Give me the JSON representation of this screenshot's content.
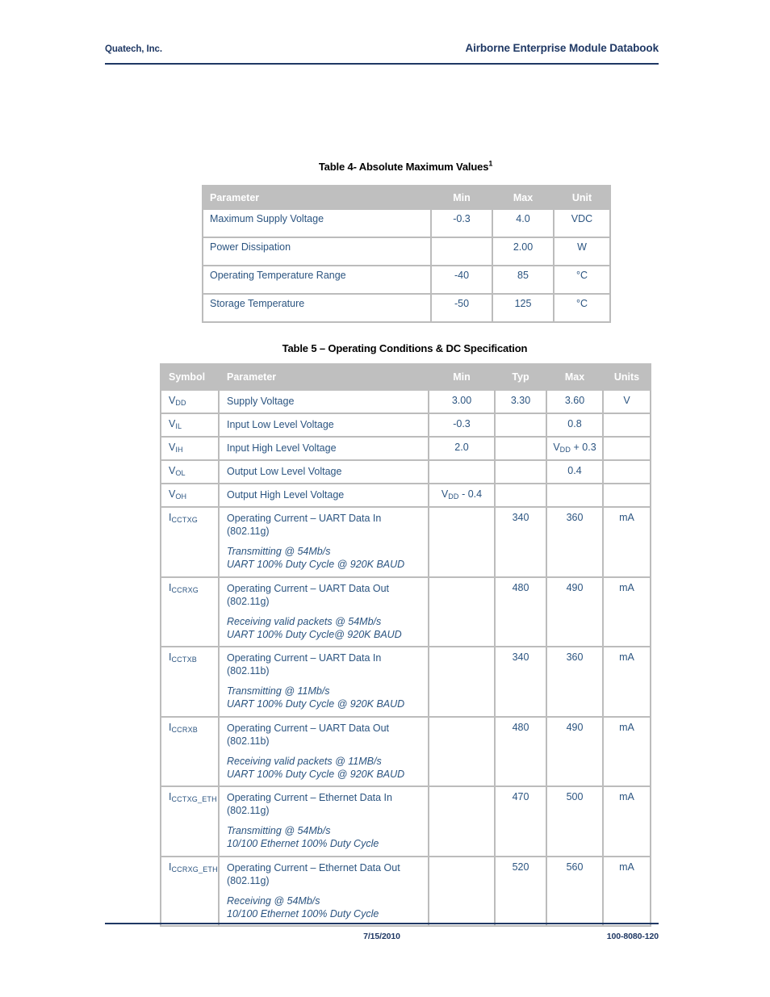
{
  "header": {
    "left": "Quatech, Inc.",
    "right": "Airborne Enterprise Module Databook"
  },
  "footer": {
    "date": "7/15/2010",
    "doc_number": "100-8080-120"
  },
  "colors": {
    "heading_blue": "#1f3864",
    "table_text_blue": "#2b5480",
    "table_header_grey": "#bfbfbf",
    "grid_grey": "#bcbcbc"
  },
  "table4": {
    "caption": "Table 4- Absolute Maximum Values",
    "caption_superscript": "1",
    "columns": [
      "Parameter",
      "Min",
      "Max",
      "Unit"
    ],
    "rows": [
      {
        "parameter": "Maximum Supply Voltage",
        "min": "-0.3",
        "max": "4.0",
        "unit": "VDC"
      },
      {
        "parameter": "Power Dissipation",
        "min": "",
        "max": "2.00",
        "unit": "W"
      },
      {
        "parameter": "Operating Temperature Range",
        "min": "-40",
        "max": "85",
        "unit": "°C"
      },
      {
        "parameter": "Storage Temperature",
        "min": "-50",
        "max": "125",
        "unit": "°C"
      }
    ]
  },
  "table5": {
    "caption": "Table 5 – Operating Conditions & DC Specification",
    "columns": [
      "Symbol",
      "Parameter",
      "Min",
      "Typ",
      "Max",
      "Units"
    ],
    "rows": [
      {
        "symbol_base": "V",
        "symbol_sub": "DD",
        "parameter": "Supply Voltage",
        "conditions": [],
        "min": "3.00",
        "typ": "3.30",
        "max": "3.60",
        "units": "V"
      },
      {
        "symbol_base": "V",
        "symbol_sub": "IL",
        "parameter": "Input Low Level Voltage",
        "conditions": [],
        "min": "-0.3",
        "typ": "",
        "max": "0.8",
        "units": ""
      },
      {
        "symbol_base": "V",
        "symbol_sub": "IH",
        "parameter": "Input High Level Voltage",
        "conditions": [],
        "min": "2.0",
        "typ": "",
        "max_base": "V",
        "max_sub": "DD",
        "max_tail": " + 0.3",
        "max": "VDD + 0.3",
        "units": ""
      },
      {
        "symbol_base": "V",
        "symbol_sub": "OL",
        "parameter": "Output Low Level Voltage",
        "conditions": [],
        "min": "",
        "typ": "",
        "max": "0.4",
        "units": ""
      },
      {
        "symbol_base": "V",
        "symbol_sub": "OH",
        "parameter": "Output High Level Voltage",
        "conditions": [],
        "min_base": "V",
        "min_sub": "DD",
        "min_tail": " - 0.4",
        "min": "VDD - 0.4",
        "typ": "",
        "max": "",
        "units": ""
      },
      {
        "symbol_base": "I",
        "symbol_sub": "CCTXG",
        "parameter": "Operating Current – UART Data In (802.11g)",
        "conditions": [
          "Transmitting @ 54Mb/s",
          "UART 100% Duty Cycle @ 920K BAUD"
        ],
        "min": "",
        "typ": "340",
        "max": "360",
        "units": "mA"
      },
      {
        "symbol_base": "I",
        "symbol_sub": "CCRXG",
        "parameter": "Operating Current – UART Data Out (802.11g)",
        "conditions": [
          "Receiving valid packets @ 54Mb/s",
          "UART 100% Duty Cycle@ 920K BAUD"
        ],
        "min": "",
        "typ": "480",
        "max": "490",
        "units": "mA"
      },
      {
        "symbol_base": "I",
        "symbol_sub": "CCTXB",
        "parameter": "Operating Current – UART Data In (802.11b)",
        "conditions": [
          "Transmitting @ 11Mb/s",
          "UART 100% Duty Cycle @ 920K BAUD"
        ],
        "min": "",
        "typ": "340",
        "max": "360",
        "units": "mA"
      },
      {
        "symbol_base": "I",
        "symbol_sub": "CCRXB",
        "parameter": "Operating Current – UART Data Out (802.11b)",
        "conditions": [
          "Receiving valid packets @ 11MB/s",
          "UART 100% Duty Cycle @ 920K BAUD"
        ],
        "min": "",
        "typ": "480",
        "max": "490",
        "units": "mA"
      },
      {
        "symbol_base": "I",
        "symbol_sub": "CCTXG_ETH",
        "parameter": "Operating Current – Ethernet Data In (802.11g)",
        "conditions": [
          "Transmitting @ 54Mb/s",
          "10/100 Ethernet 100% Duty Cycle"
        ],
        "min": "",
        "typ": "470",
        "max": "500",
        "units": "mA"
      },
      {
        "symbol_base": "I",
        "symbol_sub": "CCRXG_ETH",
        "parameter": "Operating Current – Ethernet Data Out (802.11g)",
        "conditions": [
          "Receiving @ 54Mb/s",
          "10/100 Ethernet 100% Duty Cycle"
        ],
        "min": "",
        "typ": "520",
        "max": "560",
        "units": "mA"
      }
    ]
  }
}
